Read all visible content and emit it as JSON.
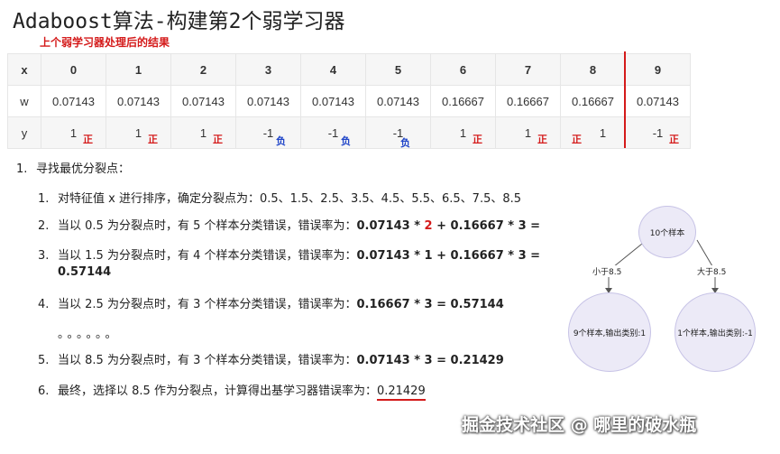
{
  "title": "Adaboost算法-构建第2个弱学习器",
  "subtitle": "上个弱学习器处理后的结果",
  "table": {
    "x_label": "x",
    "w_label": "w",
    "y_label": "y",
    "x": [
      "0",
      "1",
      "2",
      "3",
      "4",
      "5",
      "6",
      "7",
      "8",
      "9"
    ],
    "w": [
      "0.07143",
      "0.07143",
      "0.07143",
      "0.07143",
      "0.07143",
      "0.07143",
      "0.16667",
      "0.16667",
      "0.16667",
      "0.07143"
    ],
    "y": [
      "1",
      "1",
      "1",
      "-1",
      "-1",
      "-1",
      "1",
      "1",
      "1",
      "-1"
    ],
    "tags": [
      "正",
      "正",
      "正",
      "负",
      "负",
      "负",
      "正",
      "正",
      "正",
      "正"
    ]
  },
  "list": {
    "n1": "1.",
    "item1": "寻找最优分裂点：",
    "sub": [
      {
        "n": "1.",
        "text": "对特征值 x 进行排序，确定分裂点为：0.5、1.5、2.5、3.5、4.5、5.5、6.5、7.5、8.5"
      },
      {
        "n": "2.",
        "text": "当以 0.5 为分裂点时，有 5 个样本分类错误，错误率为：",
        "a": "0.07143 * ",
        "b": "2",
        "c": " + 0.16667 * 3 ="
      },
      {
        "n": "3.",
        "text": "当以 1.5 为分裂点时，有 4 个样本分类错误，错误率为：",
        "a": "0.07143 * 1 + 0.16667 * 3 =",
        "cont": "0.57144"
      },
      {
        "n": "4.",
        "text": "当以 2.5 为分裂点时，有 3 个样本分类错误，错误率为：",
        "a": "0.16667 * 3 = 0.57144"
      },
      {
        "dots": "。。。。。。"
      },
      {
        "n": "5.",
        "text": "当以 8.5 为分裂点时，有 3 个样本分类错误，错误率为：",
        "a": "0.07143 * 3  = 0.21429"
      },
      {
        "n": "6.",
        "text": "最终，选择以 8.5 作为分裂点，计算得出基学习器错误率为：",
        "a": "0.21429"
      }
    ]
  },
  "tree": {
    "root": "10个样本",
    "left_edge": "小于8.5",
    "right_edge": "大于8.5",
    "left_leaf": "9个样本,输出类别:1",
    "right_leaf": "1个样本,输出类别:-1"
  },
  "watermark": "掘金技术社区 @ 哪里的破水瓶",
  "colors": {
    "accent_red": "#d41a1a",
    "negative_blue": "#1f44c8",
    "node_fill": "#eceaf7"
  }
}
